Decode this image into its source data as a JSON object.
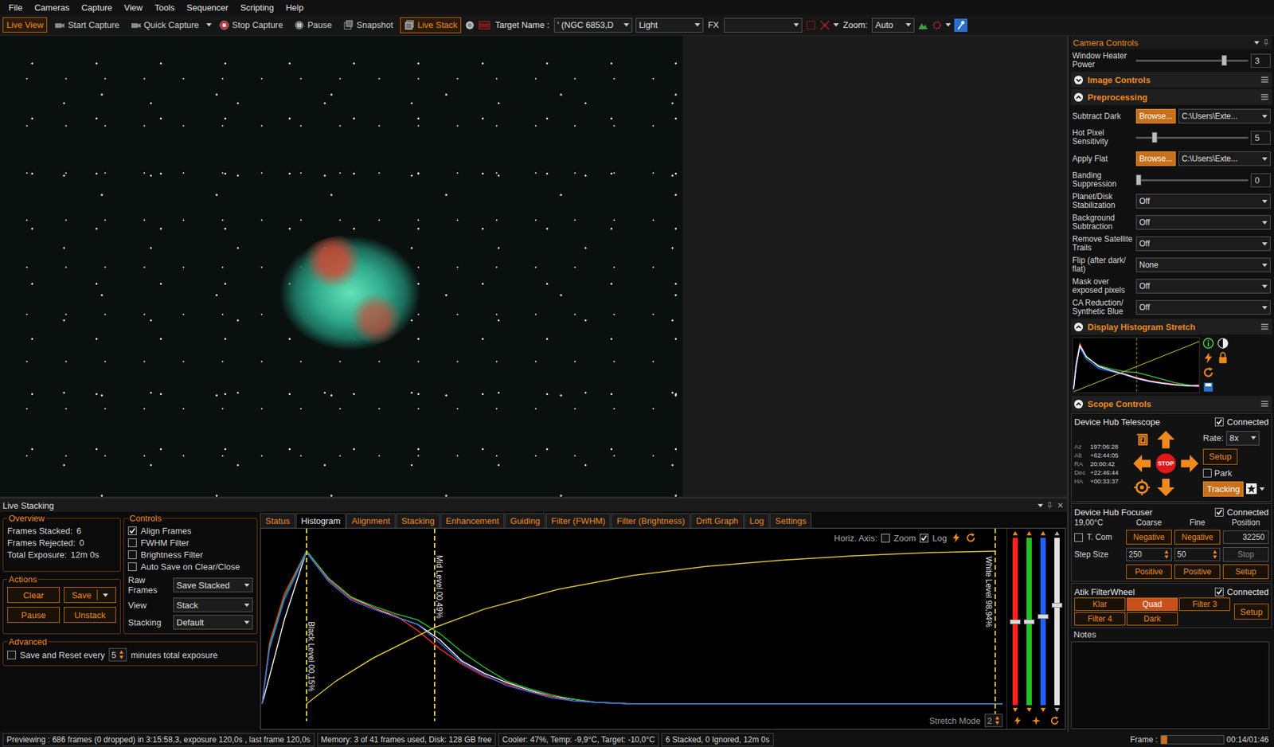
{
  "menu": [
    "File",
    "Cameras",
    "Capture",
    "View",
    "Tools",
    "Sequencer",
    "Scripting",
    "Help"
  ],
  "toolbar": {
    "buttons": [
      {
        "label": "Live View",
        "selected": true
      },
      {
        "label": "Start Capture",
        "selected": false
      },
      {
        "label": "Quick Capture",
        "selected": false
      },
      {
        "label": "Stop Capture",
        "selected": false
      },
      {
        "label": "Pause",
        "selected": false
      },
      {
        "label": "Snapshot",
        "selected": false
      },
      {
        "label": "Live Stack",
        "selected": true
      }
    ],
    "target_label": "Target Name :",
    "target": "' (NGC 6853,D",
    "frame_type": "Light",
    "fx_label": "FX",
    "zoom_label": "Zoom:",
    "zoom": "Auto"
  },
  "camera_controls": {
    "title": "Camera Controls",
    "heater": {
      "label": "Window Heater Power",
      "level": 0.8,
      "value": "3"
    }
  },
  "image_controls": {
    "title": "Image Controls",
    "expanded": false
  },
  "preprocessing": {
    "title": "Preprocessing",
    "expanded": true,
    "rows": [
      {
        "kind": "file",
        "label": "Subtract Dark",
        "button": "Browse...",
        "value": "C:\\Users\\Exte..."
      },
      {
        "kind": "slider",
        "label": "Hot Pixel Sensitivity",
        "level": 0.15,
        "value": "5"
      },
      {
        "kind": "file",
        "label": "Apply Flat",
        "button": "Browse...",
        "value": "C:\\Users\\Exte..."
      },
      {
        "kind": "slider",
        "label": "Banding Suppression",
        "level": 0,
        "value": "0"
      },
      {
        "kind": "select",
        "label": "Planet/Disk Stabilization",
        "value": "Off"
      },
      {
        "kind": "select",
        "label": "Background Subtraction",
        "value": "Off"
      },
      {
        "kind": "select",
        "label": "Remove Satellite Trails",
        "value": "Off"
      },
      {
        "kind": "select",
        "label": "Flip (after dark/ flat)",
        "value": "None"
      },
      {
        "kind": "select",
        "label": "Mask over exposed pixels",
        "value": "Off"
      },
      {
        "kind": "select",
        "label": "CA Reduction/ Synthetic Blue",
        "value": "Off"
      }
    ]
  },
  "histogram_stretch": {
    "title": "Display Histogram Stretch",
    "expanded": true,
    "mid": 0.5,
    "transfer": [
      0,
      1
    ],
    "x": [
      0,
      0.02,
      0.05,
      0.1,
      0.2,
      0.3,
      0.4,
      0.5,
      0.6,
      0.7,
      0.8,
      0.9,
      1.0
    ],
    "series": [
      {
        "color": "#ff3030",
        "values": [
          5,
          60,
          95,
          70,
          50,
          42,
          36,
          28,
          22,
          18,
          15,
          12,
          14
        ]
      },
      {
        "color": "#30c040",
        "values": [
          5,
          55,
          90,
          68,
          52,
          45,
          40,
          38,
          32,
          25,
          18,
          14,
          10
        ]
      },
      {
        "color": "#3070ff",
        "values": [
          5,
          58,
          88,
          65,
          46,
          40,
          34,
          26,
          20,
          16,
          14,
          12,
          10
        ]
      },
      {
        "color": "#ffffff",
        "values": [
          5,
          50,
          92,
          70,
          50,
          42,
          35,
          27,
          21,
          17,
          14,
          12,
          12
        ]
      }
    ]
  },
  "scope": {
    "title": "Scope Controls",
    "expanded": true,
    "telescope": {
      "name": "Device Hub Telescope",
      "connected": true,
      "connected_label": "Connected",
      "coords": [
        {
          "label": "Az",
          "value": "197:06:28"
        },
        {
          "label": "Alt",
          "value": "+62:44:05"
        },
        {
          "label": "RA",
          "value": "20:00:42"
        },
        {
          "label": "Dec",
          "value": "+22:46:44"
        },
        {
          "label": "HA",
          "value": "+00:33:37"
        }
      ],
      "stop": "STOP",
      "rate_label": "Rate:",
      "rate": "8x",
      "setup": "Setup",
      "park": {
        "label": "Park",
        "checked": false
      },
      "tracking": {
        "label": "Tracking",
        "on": true
      }
    },
    "focuser": {
      "name": "Device Hub Focuser",
      "connected": true,
      "connected_label": "Connected",
      "temp": "19,00°C",
      "headers": [
        "Coarse",
        "Fine",
        "Position"
      ],
      "tcomp": {
        "label": "T. Com",
        "checked": false
      },
      "negative": [
        "Negative",
        "Negative"
      ],
      "position": "32250",
      "step_label": "Step Size",
      "coarse": "250",
      "fine": "50",
      "stop": {
        "label": "Stop",
        "disabled": true
      },
      "positive": [
        "Positive",
        "Positive"
      ],
      "setup": "Setup"
    },
    "filter_wheel": {
      "name": "Atik FilterWheel",
      "connected": true,
      "connected_label": "Connected",
      "filters": [
        {
          "label": "Klar",
          "selected": false
        },
        {
          "label": "Quad",
          "selected": true
        },
        {
          "label": "Filter 3",
          "selected": false
        },
        {
          "label": "Filter 4",
          "selected": false
        },
        {
          "label": "Dark",
          "selected": false
        }
      ],
      "setup": "Setup"
    },
    "notes_label": "Notes"
  },
  "live_stacking": {
    "title": "Live Stacking",
    "overview": {
      "title": "Overview",
      "rows": [
        {
          "label": "Frames Stacked:",
          "value": "6"
        },
        {
          "label": "Frames Rejected:",
          "value": "0"
        },
        {
          "label": "Total Exposure:",
          "value": "12m 0s"
        }
      ]
    },
    "controls": {
      "title": "Controls",
      "checks": [
        {
          "label": "Align Frames",
          "checked": true
        },
        {
          "label": "FWHM Filter",
          "checked": false
        },
        {
          "label": "Brightness Filter",
          "checked": false
        },
        {
          "label": "Auto Save on Clear/Close",
          "checked": false
        }
      ],
      "selects": [
        {
          "label": "Raw Frames",
          "value": "Save Stacked"
        },
        {
          "label": "View",
          "value": "Stack"
        },
        {
          "label": "Stacking",
          "value": "Default"
        }
      ]
    },
    "actions": {
      "title": "Actions",
      "buttons": [
        "Clear",
        "Save",
        "Pause",
        "Unstack"
      ]
    },
    "advanced": {
      "title": "Advanced",
      "label": "Save and Reset every",
      "checked": false,
      "value": "5",
      "suffix": "minutes total exposure"
    },
    "tabs": [
      {
        "label": "Status",
        "selected": false
      },
      {
        "label": "Histogram",
        "selected": true
      },
      {
        "label": "Alignment",
        "selected": false
      },
      {
        "label": "Stacking",
        "selected": false
      },
      {
        "label": "Enhancement",
        "selected": false
      },
      {
        "label": "Guiding",
        "selected": false
      },
      {
        "label": "Filter (FWHM)",
        "selected": false
      },
      {
        "label": "Filter (Brightness)",
        "selected": false
      },
      {
        "label": "Drift Graph",
        "selected": false
      },
      {
        "label": "Log",
        "selected": false
      },
      {
        "label": "Settings",
        "selected": false
      }
    ],
    "histogram": {
      "axis_label": "Horiz. Axis:",
      "zoom": {
        "label": "Zoom",
        "checked": false
      },
      "log": {
        "label": "Log",
        "checked": true
      },
      "x": [
        0,
        0.01,
        0.03,
        0.06,
        0.09,
        0.12,
        0.15,
        0.18,
        0.21,
        0.24,
        0.27,
        0.3,
        0.33,
        0.36,
        0.39,
        0.42,
        0.45,
        0.5,
        1.0
      ],
      "series": [
        {
          "name": "white",
          "color": "#ffffff",
          "values": [
            0,
            18,
            55,
            100,
            82,
            70,
            63,
            57,
            52,
            42,
            28,
            20,
            14,
            9,
            5,
            3,
            1,
            0,
            0
          ]
        },
        {
          "name": "red",
          "color": "#ff2a2a",
          "values": [
            0,
            40,
            72,
            100,
            81,
            69,
            63,
            58,
            48,
            36,
            26,
            18,
            13,
            8,
            5,
            2,
            1,
            0,
            0
          ]
        },
        {
          "name": "green",
          "color": "#22c030",
          "values": [
            0,
            38,
            70,
            100,
            82,
            70,
            64,
            59,
            55,
            46,
            34,
            24,
            15,
            10,
            6,
            3,
            1,
            0,
            0
          ]
        },
        {
          "name": "blue",
          "color": "#3a6cff",
          "values": [
            0,
            36,
            68,
            99,
            80,
            68,
            62,
            57,
            52,
            40,
            27,
            19,
            12,
            8,
            4,
            2,
            1,
            0,
            0
          ]
        }
      ],
      "black": {
        "label": "Black Level 00,15%",
        "x": 0.06
      },
      "mid": {
        "label": "Mid Level 00,49%",
        "x": 0.233
      },
      "white": {
        "label": "White Level 98,94%",
        "x": 0.99
      },
      "curve": {
        "x": [
          0.06,
          0.1,
          0.15,
          0.233,
          0.3,
          0.4,
          0.5,
          0.6,
          0.7,
          0.8,
          0.9,
          0.99
        ],
        "y": [
          0,
          0.15,
          0.3,
          0.5,
          0.62,
          0.75,
          0.84,
          0.9,
          0.94,
          0.97,
          0.99,
          1.0
        ]
      },
      "stretch_mode": {
        "label": "Stretch Mode",
        "value": "2"
      },
      "sliders": [
        {
          "color": "#ff2020",
          "level": 0.5
        },
        {
          "color": "#20c020",
          "level": 0.5
        },
        {
          "color": "#2060ff",
          "level": 0.53
        },
        {
          "color": "#e0e0e0",
          "level": 0.6
        }
      ]
    }
  },
  "status_bar": {
    "segments": [
      "Previewing : 686 frames (0 dropped) in 3:15:58,3, exposure 120,0s , last frame 120,0s",
      "Memory: 3 of 41 frames used, Disk: 128 GB free",
      "Cooler: 47%, Temp: -9,9°C, Target: -10,0°C",
      "6 Stacked, 0 Ignored, 12m 0s"
    ],
    "frame_label": "Frame :",
    "frame_level": 0.1,
    "time": "00:14/01:46"
  }
}
